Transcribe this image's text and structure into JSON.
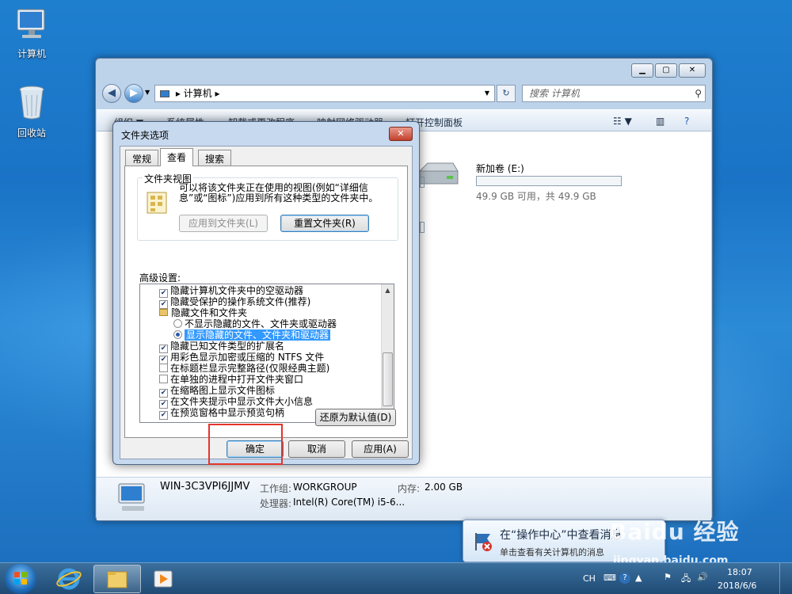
{
  "desktop": {
    "computer_label": "计算机",
    "recycle_label": "回收站"
  },
  "explorer": {
    "breadcrumb": "计算机",
    "search_placeholder": "搜索 计算机",
    "commands": [
      "组织 ▼",
      "系统属性",
      "卸载或更改程序",
      "映射网络驱动器",
      "打开控制面板"
    ],
    "drive": {
      "name": "新加卷 (E:)",
      "space": "49.9 GB 可用，共 49.9 GB"
    },
    "details": {
      "computer_name": "WIN-3C3VPI6JJMV",
      "workgroup_label": "工作组:",
      "workgroup": "WORKGROUP",
      "memory_label": "内存:",
      "memory": "2.00 GB",
      "cpu_label": "处理器:",
      "cpu": "Intel(R) Core(TM) i5-6..."
    }
  },
  "dialog": {
    "title": "文件夹选项",
    "tabs": [
      "常规",
      "查看",
      "搜索"
    ],
    "folder_views": {
      "title": "文件夹视图",
      "description": "可以将该文件夹正在使用的视图(例如“详细信息”或“图标”)应用到所有这种类型的文件夹中。",
      "apply_button": "应用到文件夹(L)",
      "reset_button": "重置文件夹(R)"
    },
    "advanced_label": "高级设置:",
    "settings": [
      {
        "kind": "check",
        "checked": true,
        "label": "隐藏计算机文件夹中的空驱动器"
      },
      {
        "kind": "check",
        "checked": true,
        "label": "隐藏受保护的操作系统文件(推荐)"
      },
      {
        "kind": "folder",
        "label": "隐藏文件和文件夹"
      },
      {
        "kind": "radio",
        "checked": false,
        "label": "不显示隐藏的文件、文件夹或驱动器"
      },
      {
        "kind": "radio",
        "checked": true,
        "selected": true,
        "label": "显示隐藏的文件、文件夹和驱动器"
      },
      {
        "kind": "check",
        "checked": true,
        "label": "隐藏已知文件类型的扩展名"
      },
      {
        "kind": "check",
        "checked": true,
        "label": "用彩色显示加密或压缩的 NTFS 文件"
      },
      {
        "kind": "check",
        "checked": false,
        "label": "在标题栏显示完整路径(仅限经典主题)"
      },
      {
        "kind": "check",
        "checked": false,
        "label": "在单独的进程中打开文件夹窗口"
      },
      {
        "kind": "check",
        "checked": true,
        "label": "在缩略图上显示文件图标"
      },
      {
        "kind": "check",
        "checked": true,
        "label": "在文件夹提示中显示文件大小信息"
      },
      {
        "kind": "check",
        "checked": true,
        "label": "在预览窗格中显示预览句柄"
      }
    ],
    "restore_button": "还原为默认值(D)",
    "ok_button": "确定",
    "cancel_button": "取消",
    "apply_button": "应用(A)"
  },
  "notification": {
    "title": "在“操作中心”中查看消息",
    "body": "单击查看有关计算机的消息"
  },
  "taskbar": {
    "lang": "CH",
    "time": "18:07",
    "date": "2018/6/6"
  },
  "watermark": {
    "brand": "Baidu 经验",
    "url": "jingyan.baidu.com"
  }
}
